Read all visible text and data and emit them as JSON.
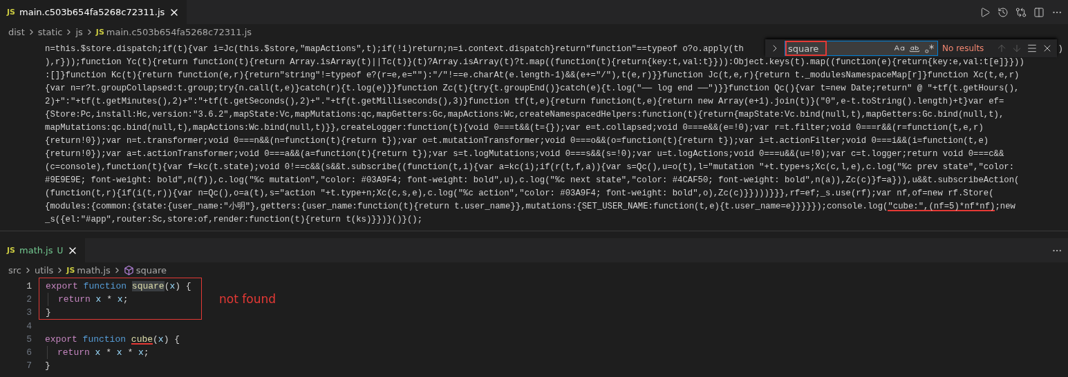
{
  "top_editor": {
    "tab": {
      "badge": "JS",
      "title": "main.c503b654fa5268c72311.js",
      "selected": true
    },
    "breadcrumb": [
      {
        "kind": "folder",
        "text": "dist"
      },
      {
        "kind": "folder",
        "text": "static"
      },
      {
        "kind": "folder",
        "text": "js"
      },
      {
        "kind": "file",
        "badge": "JS",
        "text": "main.c503b654fa5268c72311.js"
      }
    ],
    "find_widget": {
      "query": "square",
      "query_marked": true,
      "result": "No results",
      "navigation_disabled": true
    },
    "code_lines": [
      {
        "text": "n=this.$store.dispatch;if(t){var i=Jc(this.$store,\"mapActions\",t);if(!i)return;n=i.context.dispatch}return\"function\"==typeof o?o.apply(th",
        "tail": ")"
      },
      {
        "text": "),r}));function Yc(t){return function(t){return Array.isArray(t)||Tc(t)}(t)?Array.isArray(t)?t.map((function(t){return{key:t,val:t}})):Object.keys(t).map((function(e){return{key:e,val:t[e]}}))"
      },
      {
        "text": ":[]}function Kc(t){return function(e,r){return\"string\"!=typeof e?(r=e,e=\"\"):\"/\"!==e.charAt(e.length-1)&&(e+=\"/\"),t(e,r)}}function Jc(t,e,r){return t._modulesNamespaceMap[r]}function Xc(t,e,r)"
      },
      {
        "text": "{var n=r?t.groupCollapsed:t.group;try{n.call(t,e)}catch(r){t.log(e)}}function Zc(t){try{t.groupEnd()}catch(e){t.log(\"—— log end ——\")}}function Qc(){var t=new Date;return\" @ \"+tf(t.getHours(),"
      },
      {
        "text": "2)+\":\"+tf(t.getMinutes(),2)+\":\"+tf(t.getSeconds(),2)+\".\"+tf(t.getMilliseconds(),3)}function tf(t,e){return function(t,e){return new Array(e+1).join(t)}(\"0\",e-t.toString().length)+t}var ef="
      },
      {
        "text": "{Store:Pc,install:Hc,version:\"3.6.2\",mapState:Vc,mapMutations:qc,mapGetters:Gc,mapActions:Wc,createNamespacedHelpers:function(t){return{mapState:Vc.bind(null,t),mapGetters:Gc.bind(null,t),"
      },
      {
        "text": "mapMutations:qc.bind(null,t),mapActions:Wc.bind(null,t)}},createLogger:function(t){void 0===t&&(t={});var e=t.collapsed;void 0===e&&(e=!0);var r=t.filter;void 0===r&&(r=function(t,e,r)"
      },
      {
        "text": "{return!0});var n=t.transformer;void 0===n&&(n=function(t){return t});var o=t.mutationTransformer;void 0===o&&(o=function(t){return t});var i=t.actionFilter;void 0===i&&(i=function(t,e)"
      },
      {
        "text": "{return!0});var a=t.actionTransformer;void 0===a&&(a=function(t){return t});var s=t.logMutations;void 0===s&&(s=!0);var u=t.logActions;void 0===u&&(u=!0);var c=t.logger;return void 0===c&&"
      },
      {
        "text": "(c=console),function(t){var f=kc(t.state);void 0!==c&&(s&&t.subscribe((function(t,i){var a=kc(i);if(r(t,f,a)){var s=Qc(),u=o(t),l=\"mutation \"+t.type+s;Xc(c,l,e),c.log(\"%c prev state\",\"color:"
      },
      {
        "text": "#9E9E9E; font-weight: bold\",n(f)),c.log(\"%c mutation\",\"color: #03A9F4; font-weight: bold\",u),c.log(\"%c next state\",\"color: #4CAF50; font-weight: bold\",n(a)),Zc(c)}f=a})),u&&t.subscribeAction("
      },
      {
        "text": "(function(t,r){if(i(t,r)){var n=Qc(),o=a(t),s=\"action \"+t.type+n;Xc(c,s,e),c.log(\"%c action\",\"color: #03A9F4; font-weight: bold\",o),Zc(c)}})))}}},rf=ef;_s.use(rf);var nf,of=new rf.Store("
      },
      {
        "parts": [
          {
            "text": "{modules:{common:{state:{user_name:\"小明\"},getters:{user_name:function(t){return t.user_name}},mutations:{SET_USER_NAME:function(t,e){t.user_name=e}}}}});console.log(",
            "underlined": false
          },
          {
            "text": "\"cube:\",(nf=5)*nf*nf)",
            "underlined": true
          },
          {
            "text": ";new",
            "underlined": false
          }
        ]
      },
      {
        "text": "_s({el:\"#app\",router:Sc,store:of,render:function(t){return t(ks)}})}()}();"
      }
    ]
  },
  "bottom_editor": {
    "tab": {
      "badge": "JS",
      "title": "math.js",
      "status": "U",
      "selected": true
    },
    "breadcrumb": [
      {
        "kind": "folder",
        "text": "src"
      },
      {
        "kind": "folder",
        "text": "utils"
      },
      {
        "kind": "file",
        "badge": "JS",
        "text": "math.js"
      },
      {
        "kind": "symbol",
        "text": "square"
      }
    ],
    "groups": [
      {
        "boxed": true,
        "note": "not found",
        "lines": [
          {
            "number": "1",
            "current": true,
            "indent": false,
            "tokens": [
              {
                "kind": "keyword",
                "text": "export "
              },
              {
                "kind": "storage",
                "text": "function "
              },
              {
                "kind": "function",
                "text": "square",
                "highlighted": true
              },
              {
                "kind": "plain",
                "text": "("
              },
              {
                "kind": "param",
                "text": "x"
              },
              {
                "kind": "plain",
                "text": ") {"
              }
            ]
          },
          {
            "number": "2",
            "current": false,
            "indent": true,
            "tokens": [
              {
                "kind": "keyword",
                "text": "return "
              },
              {
                "kind": "param",
                "text": "x"
              },
              {
                "kind": "plain",
                "text": " * "
              },
              {
                "kind": "param",
                "text": "x"
              },
              {
                "kind": "plain",
                "text": ";"
              }
            ]
          },
          {
            "number": "3",
            "current": false,
            "indent": false,
            "tokens": [
              {
                "kind": "plain",
                "text": "}"
              }
            ]
          }
        ]
      },
      {
        "boxed": false,
        "lines": [
          {
            "number": "4",
            "current": false,
            "indent": false
          },
          {
            "number": "5",
            "current": false,
            "indent": false,
            "tokens": [
              {
                "kind": "keyword",
                "text": "export "
              },
              {
                "kind": "storage",
                "text": "function "
              },
              {
                "kind": "function",
                "text": "cube",
                "underlined": true
              },
              {
                "kind": "plain",
                "text": "("
              },
              {
                "kind": "param",
                "text": "x"
              },
              {
                "kind": "plain",
                "text": ") {"
              }
            ]
          },
          {
            "number": "6",
            "current": false,
            "indent": true,
            "tokens": [
              {
                "kind": "keyword",
                "text": "return "
              },
              {
                "kind": "param",
                "text": "x"
              },
              {
                "kind": "plain",
                "text": " * "
              },
              {
                "kind": "param",
                "text": "x"
              },
              {
                "kind": "plain",
                "text": " * "
              },
              {
                "kind": "param",
                "text": "x"
              },
              {
                "kind": "plain",
                "text": ";"
              }
            ]
          },
          {
            "number": "7",
            "current": false,
            "indent": false,
            "tokens": [
              {
                "kind": "plain",
                "text": "}"
              }
            ]
          }
        ]
      }
    ]
  }
}
